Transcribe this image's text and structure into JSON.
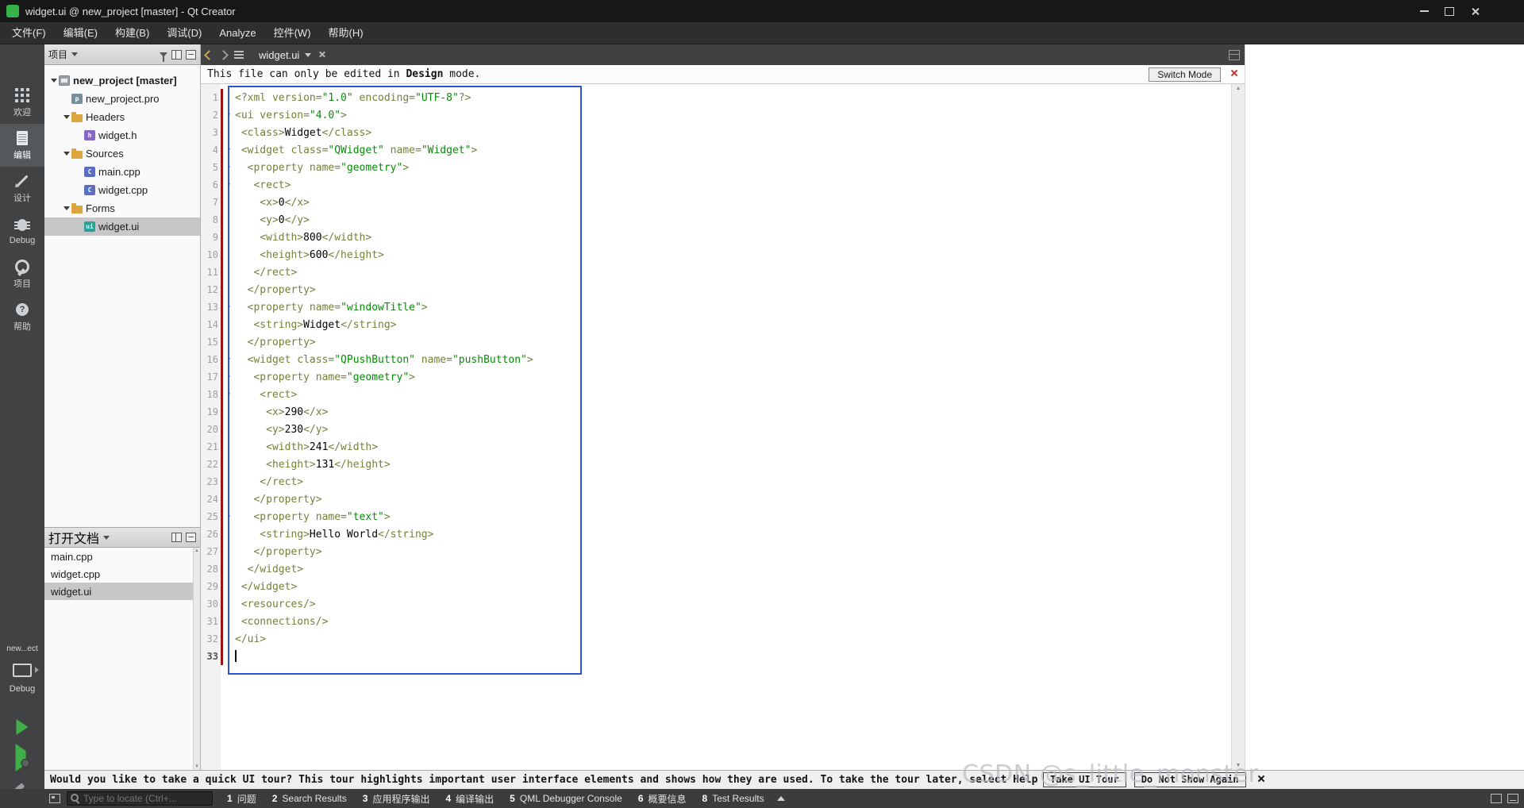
{
  "window": {
    "title": "widget.ui @ new_project [master] - Qt Creator"
  },
  "menubar": {
    "items": [
      "文件(F)",
      "编辑(E)",
      "构建(B)",
      "调试(D)",
      "Analyze",
      "控件(W)",
      "帮助(H)"
    ]
  },
  "modebar": {
    "modes": [
      {
        "id": "welcome",
        "label": "欢迎",
        "active": false
      },
      {
        "id": "edit",
        "label": "编辑",
        "active": true
      },
      {
        "id": "design",
        "label": "设计",
        "active": false
      },
      {
        "id": "debug",
        "label": "Debug",
        "active": false
      },
      {
        "id": "projects",
        "label": "项目",
        "active": false
      },
      {
        "id": "help",
        "label": "帮助",
        "active": false
      }
    ],
    "kit": {
      "project": "new...ect",
      "target": "Debug"
    }
  },
  "project_panel": {
    "header": "项目",
    "tree": [
      {
        "label": "new_project [master]",
        "depth": 0,
        "icon": "project",
        "expand": true,
        "bold": true
      },
      {
        "label": "new_project.pro",
        "depth": 1,
        "icon": "pro"
      },
      {
        "label": "Headers",
        "depth": 1,
        "icon": "folder",
        "expand": true
      },
      {
        "label": "widget.h",
        "depth": 2,
        "icon": "h"
      },
      {
        "label": "Sources",
        "depth": 1,
        "icon": "folder",
        "expand": true
      },
      {
        "label": "main.cpp",
        "depth": 2,
        "icon": "cpp"
      },
      {
        "label": "widget.cpp",
        "depth": 2,
        "icon": "cpp"
      },
      {
        "label": "Forms",
        "depth": 1,
        "icon": "folder",
        "expand": true
      },
      {
        "label": "widget.ui",
        "depth": 2,
        "icon": "ui",
        "selected": true
      }
    ]
  },
  "open_documents": {
    "header": "打开文档",
    "items": [
      {
        "label": "main.cpp"
      },
      {
        "label": "widget.cpp"
      },
      {
        "label": "widget.ui",
        "selected": true
      }
    ]
  },
  "editor": {
    "tab": "widget.ui",
    "infobar": {
      "message_prefix": "This file can only be edited in ",
      "message_bold": "Design",
      "message_suffix": " mode.",
      "button": "Switch Mode"
    },
    "code": {
      "lines": [
        {
          "n": 1,
          "spans": [
            [
              "t",
              "<?xml version="
            ],
            [
              "s",
              "\"1.0\""
            ],
            [
              "t",
              " encoding="
            ],
            [
              "s",
              "\"UTF-8\""
            ],
            [
              "t",
              "?>"
            ]
          ]
        },
        {
          "n": 2,
          "fold": true,
          "spans": [
            [
              "t",
              "<ui version="
            ],
            [
              "s",
              "\"4.0\""
            ],
            [
              "t",
              ">"
            ]
          ]
        },
        {
          "n": 3,
          "spans": [
            [
              "t",
              " <class>"
            ],
            [
              "p",
              "Widget"
            ],
            [
              "t",
              "</class>"
            ]
          ]
        },
        {
          "n": 4,
          "fold": true,
          "spans": [
            [
              "t",
              " <widget class="
            ],
            [
              "s",
              "\"QWidget\""
            ],
            [
              "t",
              " name="
            ],
            [
              "s",
              "\"Widget\""
            ],
            [
              "t",
              ">"
            ]
          ]
        },
        {
          "n": 5,
          "fold": true,
          "spans": [
            [
              "t",
              "  <property name="
            ],
            [
              "s",
              "\"geometry\""
            ],
            [
              "t",
              ">"
            ]
          ]
        },
        {
          "n": 6,
          "fold": true,
          "spans": [
            [
              "t",
              "   <rect>"
            ]
          ]
        },
        {
          "n": 7,
          "spans": [
            [
              "t",
              "    <x>"
            ],
            [
              "p",
              "0"
            ],
            [
              "t",
              "</x>"
            ]
          ]
        },
        {
          "n": 8,
          "spans": [
            [
              "t",
              "    <y>"
            ],
            [
              "p",
              "0"
            ],
            [
              "t",
              "</y>"
            ]
          ]
        },
        {
          "n": 9,
          "spans": [
            [
              "t",
              "    <width>"
            ],
            [
              "p",
              "800"
            ],
            [
              "t",
              "</width>"
            ]
          ]
        },
        {
          "n": 10,
          "spans": [
            [
              "t",
              "    <height>"
            ],
            [
              "p",
              "600"
            ],
            [
              "t",
              "</height>"
            ]
          ]
        },
        {
          "n": 11,
          "spans": [
            [
              "t",
              "   </rect>"
            ]
          ]
        },
        {
          "n": 12,
          "spans": [
            [
              "t",
              "  </property>"
            ]
          ]
        },
        {
          "n": 13,
          "fold": true,
          "spans": [
            [
              "t",
              "  <property name="
            ],
            [
              "s",
              "\"windowTitle\""
            ],
            [
              "t",
              ">"
            ]
          ]
        },
        {
          "n": 14,
          "spans": [
            [
              "t",
              "   <string>"
            ],
            [
              "p",
              "Widget"
            ],
            [
              "t",
              "</string>"
            ]
          ]
        },
        {
          "n": 15,
          "spans": [
            [
              "t",
              "  </property>"
            ]
          ]
        },
        {
          "n": 16,
          "fold": true,
          "spans": [
            [
              "t",
              "  <widget class="
            ],
            [
              "s",
              "\"QPushButton\""
            ],
            [
              "t",
              " name="
            ],
            [
              "s",
              "\"pushButton\""
            ],
            [
              "t",
              ">"
            ]
          ]
        },
        {
          "n": 17,
          "fold": true,
          "spans": [
            [
              "t",
              "   <property name="
            ],
            [
              "s",
              "\"geometry\""
            ],
            [
              "t",
              ">"
            ]
          ]
        },
        {
          "n": 18,
          "fold": true,
          "spans": [
            [
              "t",
              "    <rect>"
            ]
          ]
        },
        {
          "n": 19,
          "spans": [
            [
              "t",
              "     <x>"
            ],
            [
              "p",
              "290"
            ],
            [
              "t",
              "</x>"
            ]
          ]
        },
        {
          "n": 20,
          "spans": [
            [
              "t",
              "     <y>"
            ],
            [
              "p",
              "230"
            ],
            [
              "t",
              "</y>"
            ]
          ]
        },
        {
          "n": 21,
          "spans": [
            [
              "t",
              "     <width>"
            ],
            [
              "p",
              "241"
            ],
            [
              "t",
              "</width>"
            ]
          ]
        },
        {
          "n": 22,
          "spans": [
            [
              "t",
              "     <height>"
            ],
            [
              "p",
              "131"
            ],
            [
              "t",
              "</height>"
            ]
          ]
        },
        {
          "n": 23,
          "spans": [
            [
              "t",
              "    </rect>"
            ]
          ]
        },
        {
          "n": 24,
          "spans": [
            [
              "t",
              "   </property>"
            ]
          ]
        },
        {
          "n": 25,
          "fold": true,
          "spans": [
            [
              "t",
              "   <property name="
            ],
            [
              "s",
              "\"text\""
            ],
            [
              "t",
              ">"
            ]
          ]
        },
        {
          "n": 26,
          "spans": [
            [
              "t",
              "    <string>"
            ],
            [
              "p",
              "Hello World"
            ],
            [
              "t",
              "</string>"
            ]
          ]
        },
        {
          "n": 27,
          "spans": [
            [
              "t",
              "   </property>"
            ]
          ]
        },
        {
          "n": 28,
          "spans": [
            [
              "t",
              "  </widget>"
            ]
          ]
        },
        {
          "n": 29,
          "spans": [
            [
              "t",
              " </widget>"
            ]
          ]
        },
        {
          "n": 30,
          "spans": [
            [
              "t",
              " <resources/>"
            ]
          ]
        },
        {
          "n": 31,
          "spans": [
            [
              "t",
              " <connections/>"
            ]
          ]
        },
        {
          "n": 32,
          "spans": [
            [
              "t",
              "</ui>"
            ]
          ]
        },
        {
          "n": 33,
          "cursor": true,
          "spans": []
        }
      ]
    }
  },
  "notification": {
    "message": "Would you like to take a quick UI tour? This tour highlights important user interface elements and shows how they are used. To take the tour later, select Help > UI Tour.",
    "take_button": "Take UI Tour",
    "dismiss_button": "Do Not Show Again"
  },
  "watermark": "CSDN @s_little_monster",
  "statusbar": {
    "locator_placeholder": "Type to locate (Ctrl+...",
    "panes": [
      {
        "num": "1",
        "label": "问题"
      },
      {
        "num": "2",
        "label": "Search Results"
      },
      {
        "num": "3",
        "label": "应用程序输出"
      },
      {
        "num": "4",
        "label": "编译输出"
      },
      {
        "num": "5",
        "label": "QML Debugger Console"
      },
      {
        "num": "6",
        "label": "概要信息"
      },
      {
        "num": "8",
        "label": "Test Results"
      }
    ]
  },
  "colors": {
    "selection_box_blue": "#2d53cf",
    "change_bar_red": "#9d1111",
    "xml_tag_green": "#71823b",
    "xml_value_green": "#0a8a0a",
    "run_green": "#3fae49"
  }
}
